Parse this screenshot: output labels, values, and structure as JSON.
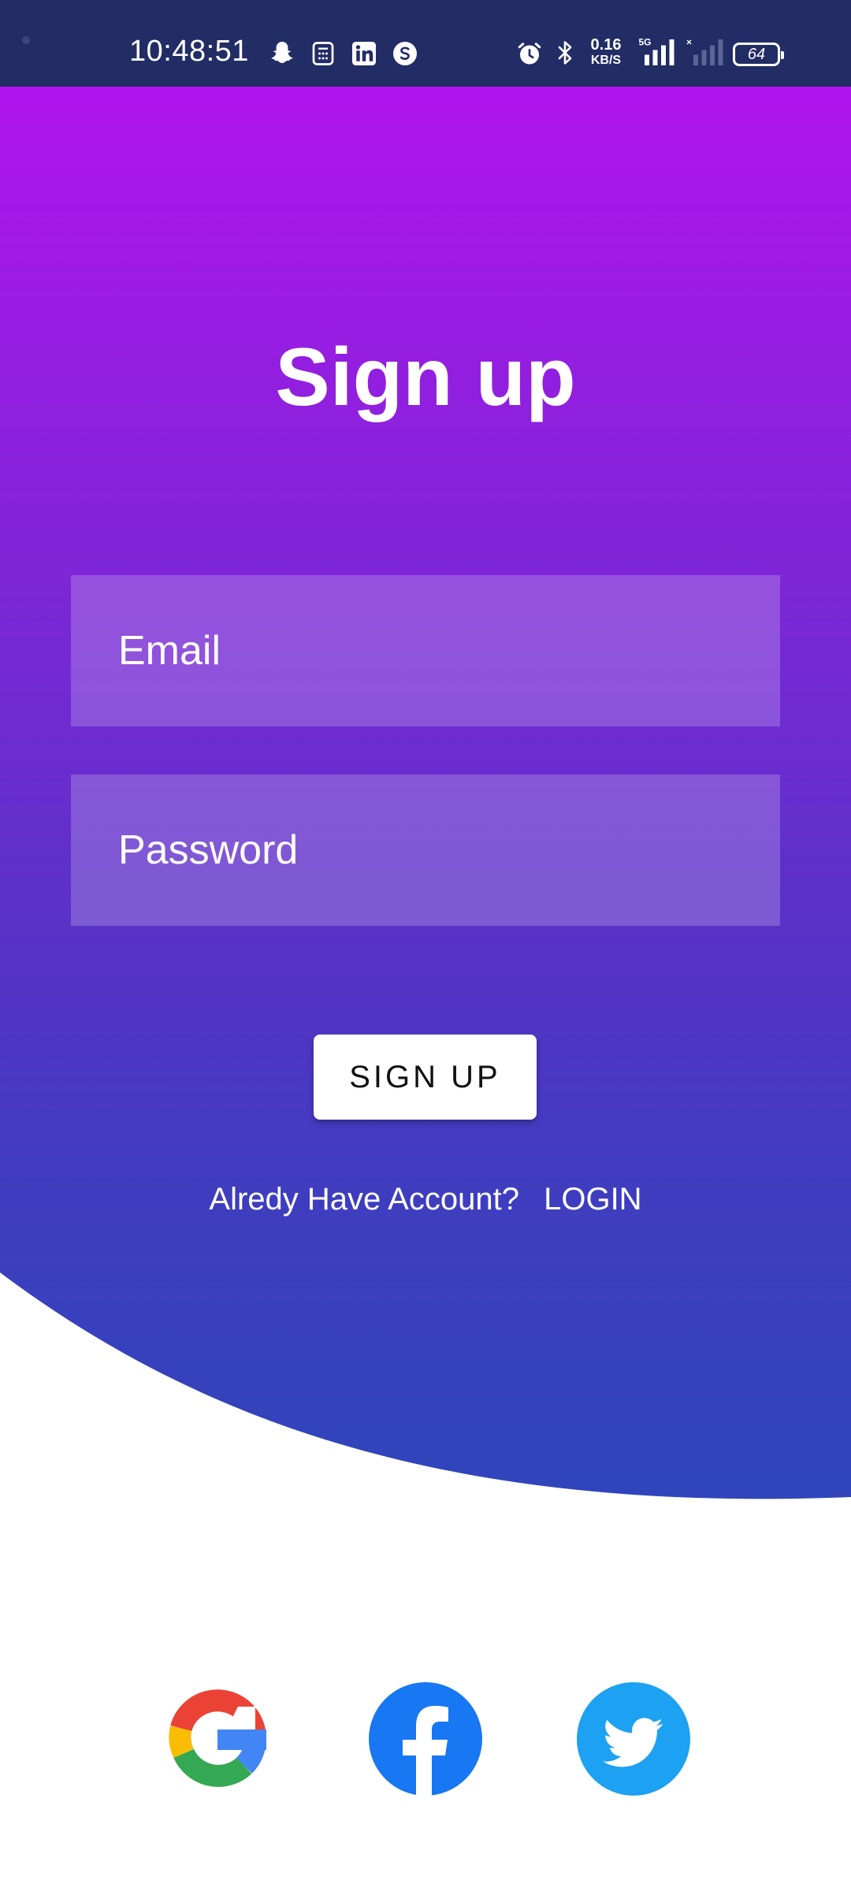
{
  "status_bar": {
    "time": "10:48:51",
    "net_speed_value": "0.16",
    "net_speed_unit": "KB/S",
    "battery_level": "64",
    "network_label": "5G",
    "background_color": "#222d66"
  },
  "signup": {
    "title": "Sign up",
    "email_placeholder": "Email",
    "password_placeholder": "Password",
    "submit_label": "SIGN UP",
    "account_prompt": "Alredy Have Account?",
    "login_label": "LOGIN"
  },
  "colors": {
    "gradient_top": "#b114ec",
    "gradient_bottom": "#2f45bb",
    "google": [
      "#ea4335",
      "#fbbc05",
      "#34a853",
      "#4285f4"
    ],
    "facebook": "#1877f2",
    "twitter": "#1da1f2"
  },
  "social_icons": [
    "google-icon",
    "facebook-icon",
    "twitter-icon"
  ]
}
